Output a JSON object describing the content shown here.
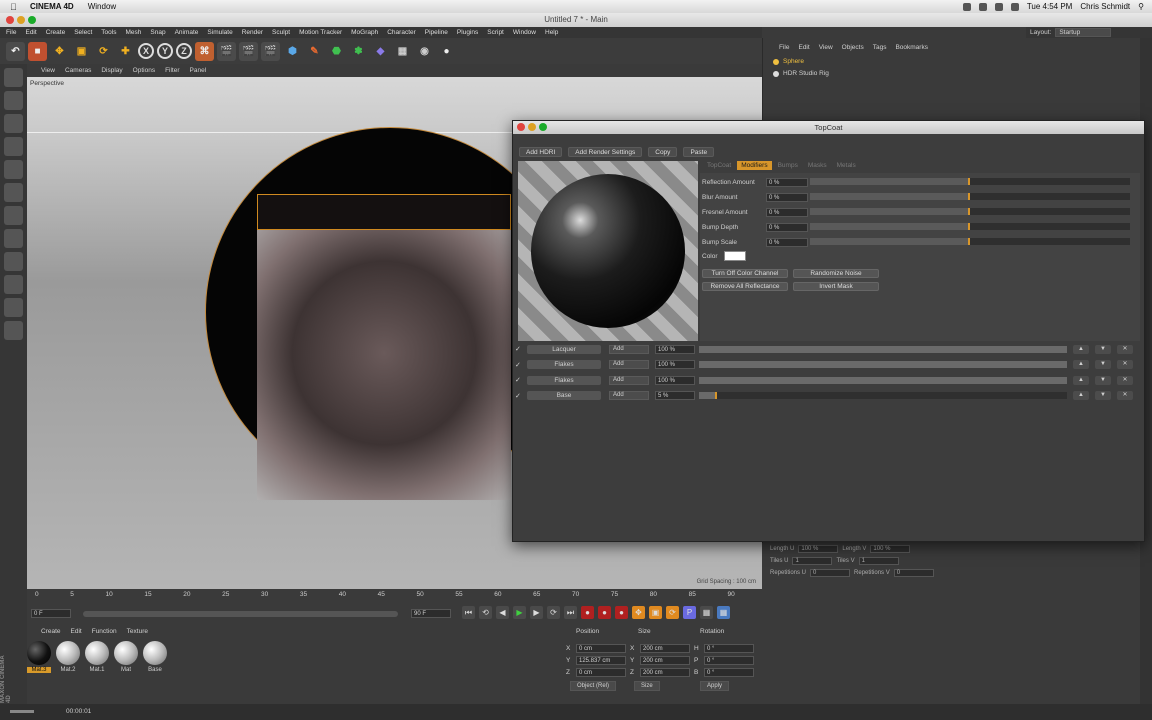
{
  "macbar": {
    "app_name": "CINEMA 4D",
    "menu": [
      "Window"
    ],
    "clock": "Tue 4:54 PM",
    "user": "Chris Schmidt"
  },
  "window": {
    "title": "Untitled 7 * - Main"
  },
  "c4d_menu": [
    "File",
    "Edit",
    "Create",
    "Select",
    "Tools",
    "Mesh",
    "Snap",
    "Animate",
    "Simulate",
    "Render",
    "Sculpt",
    "Motion Tracker",
    "MoGraph",
    "Character",
    "Pipeline",
    "Plugins",
    "Script",
    "Window",
    "Help"
  ],
  "layout": {
    "label": "Layout:",
    "value": "Startup"
  },
  "toolbar": {
    "x": "X",
    "y": "Y",
    "z": "Z"
  },
  "viewport": {
    "menu": [
      "View",
      "Cameras",
      "Display",
      "Options",
      "Filter",
      "Panel"
    ],
    "camera_label": "Perspective",
    "grid_info": "Grid Spacing : 100 cm"
  },
  "timeline": {
    "ticks": [
      "0",
      "5",
      "10",
      "15",
      "20",
      "25",
      "30",
      "35",
      "40",
      "45",
      "50",
      "55",
      "60",
      "65",
      "70",
      "75",
      "80",
      "85",
      "90"
    ],
    "current_frame": "0 F",
    "start_field": "0 F",
    "end_field": "90 F",
    "mid_field": "90 F",
    "right_field": "0 F"
  },
  "material_manager": {
    "menu": [
      "Create",
      "Edit",
      "Function",
      "Texture"
    ],
    "materials": [
      {
        "name": "Mat.3",
        "selected": true,
        "dark": true
      },
      {
        "name": "Mat.2",
        "selected": false,
        "dark": false
      },
      {
        "name": "Mat.1",
        "selected": false,
        "dark": false
      },
      {
        "name": "Mat",
        "selected": false,
        "dark": false
      },
      {
        "name": "Base",
        "selected": false,
        "dark": false
      }
    ],
    "brand": "MAXON CINEMA 4D"
  },
  "coordinates": {
    "headers": {
      "position": "Position",
      "size": "Size",
      "rotation": "Rotation"
    },
    "rows": [
      {
        "axis": "X",
        "pos": "0 cm",
        "size_axis": "X",
        "size": "200 cm",
        "rot_axis": "H",
        "rot": "0 °"
      },
      {
        "axis": "Y",
        "pos": "125.837 cm",
        "size_axis": "Y",
        "size": "200 cm",
        "rot_axis": "P",
        "rot": "0 °"
      },
      {
        "axis": "Z",
        "pos": "0 cm",
        "size_axis": "Z",
        "size": "200 cm",
        "rot_axis": "B",
        "rot": "0 °"
      }
    ],
    "mode": "Object (Rel)",
    "size_mode": "Size",
    "apply": "Apply"
  },
  "status": {
    "time": "00:00:01"
  },
  "object_manager": {
    "menu": [
      "File",
      "Edit",
      "View",
      "Objects",
      "Tags",
      "Bookmarks"
    ],
    "objects": [
      {
        "name": "Sphere",
        "color": "#f0c040"
      },
      {
        "name": "HDR Studio Rig",
        "color": "#dddddd"
      }
    ]
  },
  "attributes": {
    "rows": [
      {
        "l1": "Length U",
        "v1": "100 %",
        "l2": "Length V",
        "v2": "100 %"
      },
      {
        "l1": "Tiles U",
        "v1": "1",
        "l2": "Tiles V",
        "v2": "1"
      },
      {
        "l1": "Repetitions U",
        "v1": "0",
        "l2": "Repetitions V",
        "v2": "0"
      }
    ]
  },
  "topcoat": {
    "title": "TopCoat",
    "buttons": [
      "Add HDRI",
      "Add Render Settings",
      "Copy",
      "Paste"
    ],
    "tabs": [
      {
        "label": "TopCoat",
        "active": false
      },
      {
        "label": "Modifiers",
        "active": true
      },
      {
        "label": "Bumps",
        "active": false
      },
      {
        "label": "Masks",
        "active": false
      },
      {
        "label": "Metals",
        "active": false
      }
    ],
    "modifiers": [
      {
        "label": "Reflection Amount",
        "value": "0 %",
        "fill": 0.5
      },
      {
        "label": "Blur Amount",
        "value": "0 %",
        "fill": 0.5
      },
      {
        "label": "Fresnel Amount",
        "value": "0 %",
        "fill": 0.5
      },
      {
        "label": "Bump Depth",
        "value": "0 %",
        "fill": 0.5
      },
      {
        "label": "Bump Scale",
        "value": "0 %",
        "fill": 0.5
      }
    ],
    "color_label": "Color",
    "actions": [
      "Turn Off Color Channel",
      "Randomize Noise",
      "Remove All Reflectance",
      "Invert Mask"
    ],
    "layers": [
      {
        "name": "Lacquer",
        "mode": "Add",
        "pct": "100 %",
        "fill": 1.0
      },
      {
        "name": "Flakes",
        "mode": "Add",
        "pct": "100 %",
        "fill": 1.0
      },
      {
        "name": "Flakes",
        "mode": "Add",
        "pct": "100 %",
        "fill": 1.0
      },
      {
        "name": "Base",
        "mode": "Add",
        "pct": "5 %",
        "fill": 0.05
      }
    ]
  }
}
